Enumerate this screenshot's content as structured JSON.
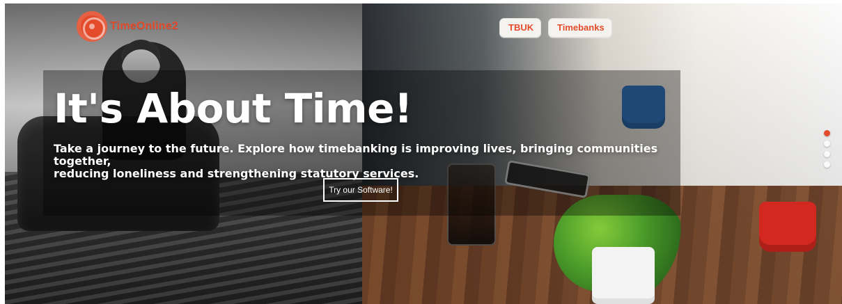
{
  "brand": {
    "name": "TimeOnline2",
    "logo": "timeonline2-logo"
  },
  "nav": {
    "items": [
      {
        "label": "TBUK"
      },
      {
        "label": "Timebanks"
      }
    ]
  },
  "hero": {
    "headline": "It's About Time!",
    "subheadline_line1": "Take a journey to the future. Explore how timebanking is improving lives, bringing communities together,",
    "subheadline_line2": "reducing loneliness and strengthening statutory services.",
    "cta_label": "Try our Software!"
  },
  "slider": {
    "dots": 4,
    "active_index": 0
  },
  "colors": {
    "brand_orange": "#e34b2b",
    "overlay": "rgba(0,0,0,0.35)",
    "white": "#ffffff"
  }
}
